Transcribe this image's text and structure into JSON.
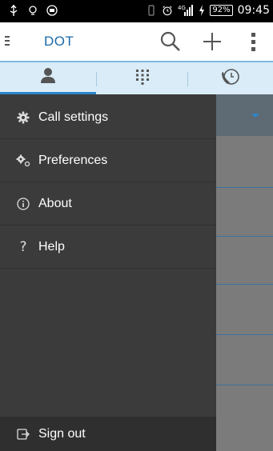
{
  "status_bar": {
    "battery": "92%",
    "time": "09:45",
    "network": "4G"
  },
  "app_bar": {
    "title": "DOT",
    "icons": [
      "menu-icon",
      "search-icon",
      "add-icon",
      "overflow-icon"
    ]
  },
  "tabs": [
    {
      "icon": "contacts-icon",
      "active": true
    },
    {
      "icon": "dialpad-icon",
      "active": false
    },
    {
      "icon": "call-history-icon",
      "active": false
    }
  ],
  "drawer": {
    "items": [
      {
        "label": "Call settings",
        "icon": "gear-icon"
      },
      {
        "label": "Preferences",
        "icon": "gears-icon"
      },
      {
        "label": "About",
        "icon": "info-icon"
      },
      {
        "label": "Help",
        "icon": "help-icon"
      }
    ],
    "signout_label": "Sign out"
  },
  "colors": {
    "accent": "#2b86c9",
    "title": "#1a6aa8",
    "drawer_bg": "#3b3b3b",
    "tab_bg": "#d9ecf7"
  }
}
